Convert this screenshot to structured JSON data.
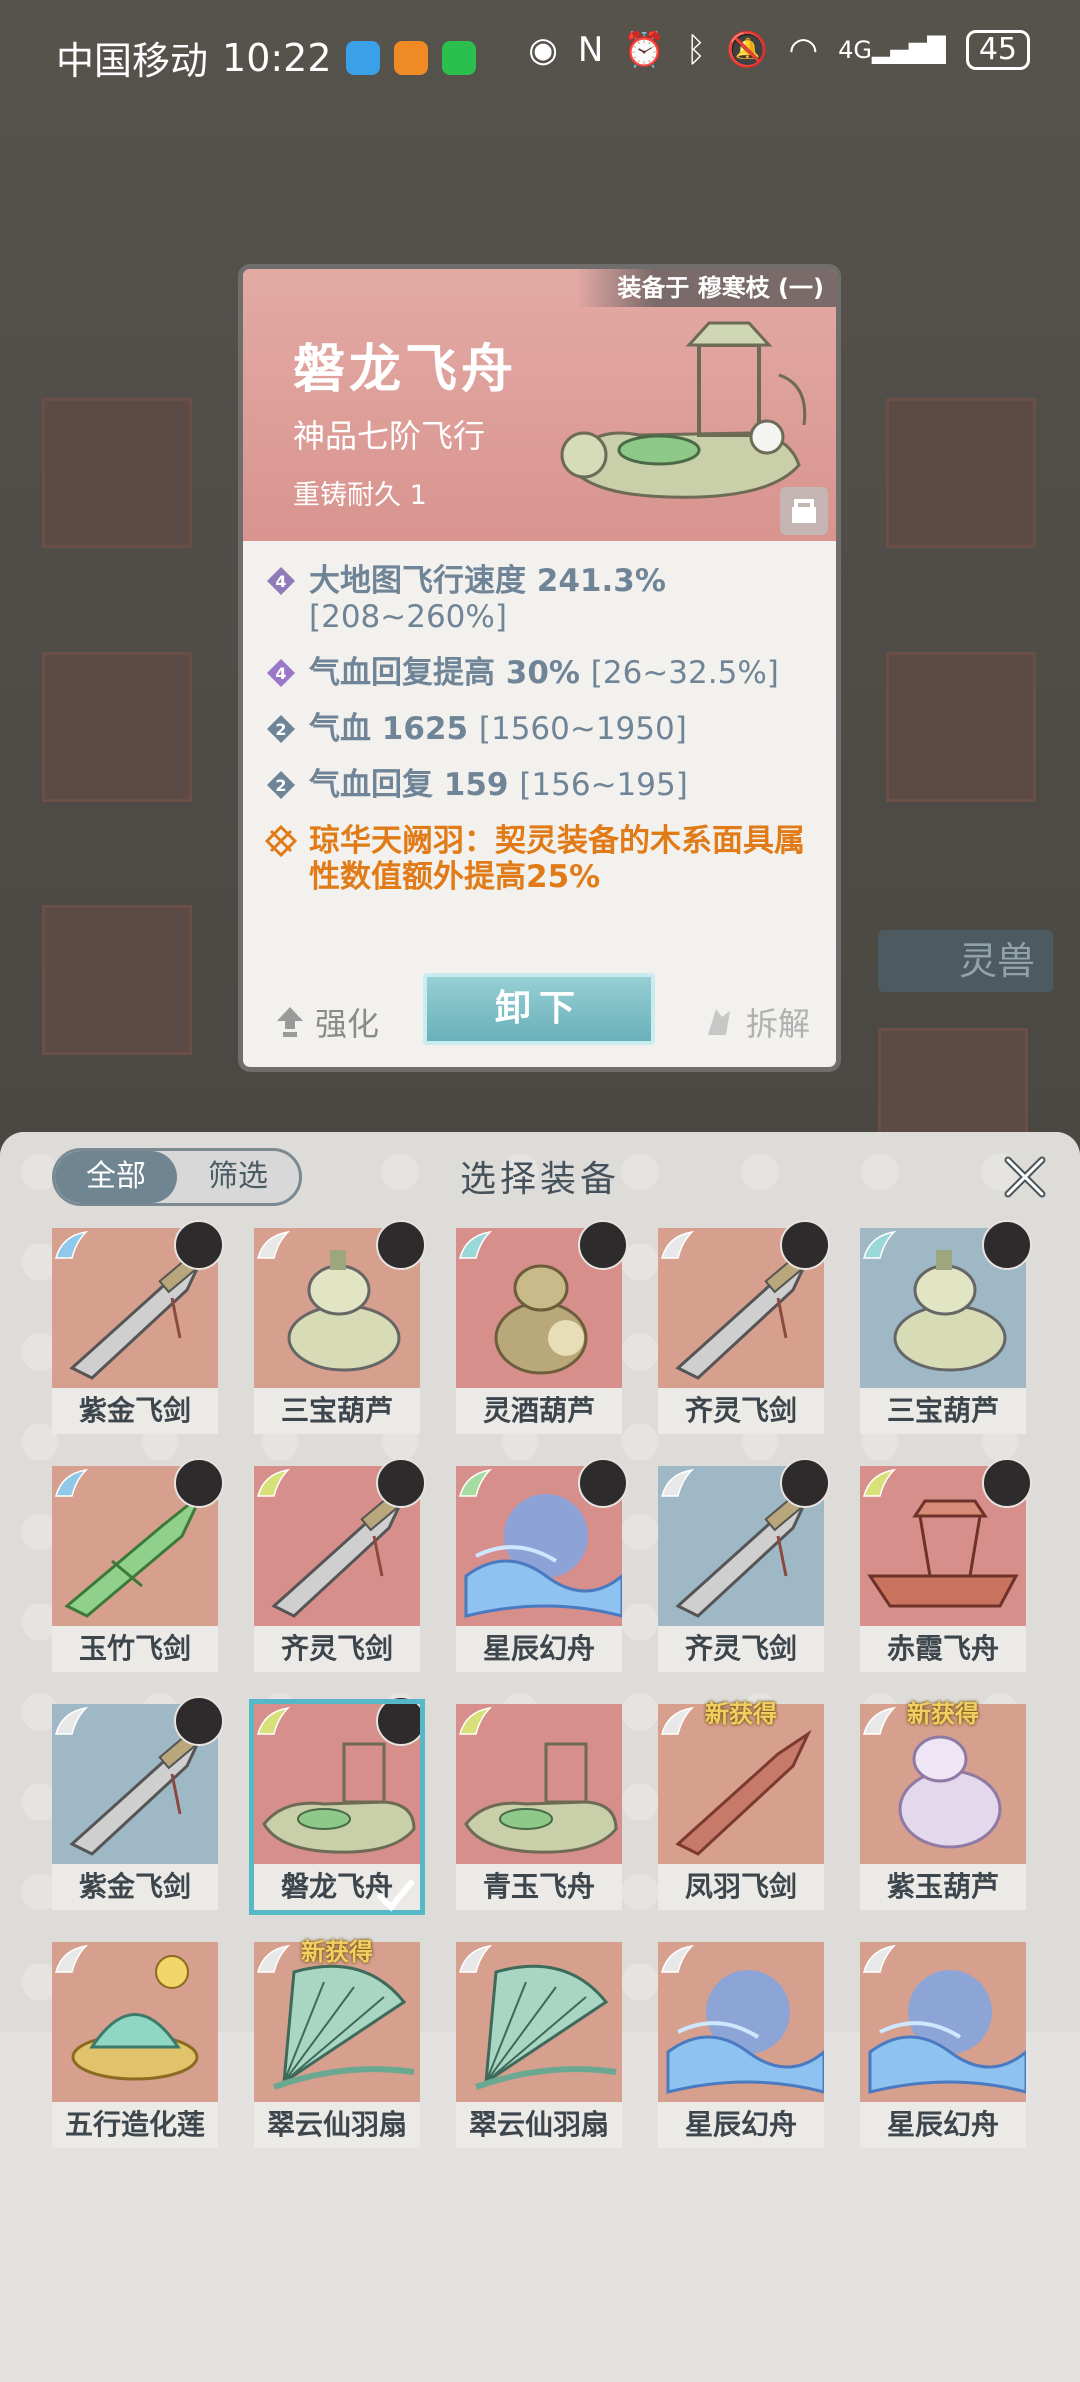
{
  "status_bar": {
    "carrier": "中国移动",
    "time": "10:22",
    "battery": "45",
    "network": "4G"
  },
  "background": {
    "side_tab": "灵兽"
  },
  "item_popup": {
    "equipped_on": "装备于 穆寒枝 (一)",
    "name": "磐龙飞舟",
    "grade": "神品七阶飞行",
    "durability": "重铸耐久 1",
    "attributes": [
      {
        "text": "大地图飞行速度 241.3%",
        "range": "[208~260%]",
        "badge": "4",
        "color": "#8e7bb7"
      },
      {
        "text": "气血回复提高 30%",
        "range": "[26~32.5%]",
        "badge": "4",
        "color": "#9b77c9"
      },
      {
        "text": "气血 1625",
        "range": "[1560~1950]",
        "badge": "2",
        "color": "#6f8597"
      },
      {
        "text": "气血回复 159",
        "range": "[156~195]",
        "badge": "2",
        "color": "#6f8597"
      }
    ],
    "special": "琼华天阙羽：契灵装备的木系面具属性数值额外提高25%",
    "strengthen": "强化",
    "unequip": "卸下",
    "dismantle": "拆解"
  },
  "sheet": {
    "title": "选择装备",
    "tabs": [
      "全部",
      "筛选"
    ],
    "active_tab": 0,
    "new_label": "新获得",
    "items": [
      {
        "name": "紫金飞剑",
        "bg": "#d7a08e",
        "art": "sword",
        "wing": "#8fc8e8",
        "avatar": true
      },
      {
        "name": "三宝葫芦",
        "bg": "#d7a08e",
        "art": "gourd",
        "wing": "#e8e8e8",
        "avatar": true
      },
      {
        "name": "灵酒葫芦",
        "bg": "#d78f8c",
        "art": "gourd2",
        "wing": "#9ad7d9",
        "avatar": true
      },
      {
        "name": "齐灵飞剑",
        "bg": "#d7a08e",
        "art": "sword",
        "wing": "#e8e8e8",
        "avatar": true
      },
      {
        "name": "三宝葫芦",
        "bg": "#9fb8c6",
        "art": "gourd",
        "wing": "#9ad7d9",
        "avatar": true
      },
      {
        "name": "玉竹飞剑",
        "bg": "#d7a08e",
        "art": "greensword",
        "wing": "#8fc8e8",
        "avatar": true
      },
      {
        "name": "齐灵飞剑",
        "bg": "#d78f8c",
        "art": "sword",
        "wing": "#d8e07a",
        "avatar": true
      },
      {
        "name": "星辰幻舟",
        "bg": "#d78f8c",
        "art": "bluewave",
        "wing": "#a7dca0",
        "avatar": true
      },
      {
        "name": "齐灵飞剑",
        "bg": "#9fb8c6",
        "art": "sword",
        "wing": "#e8e8e8",
        "avatar": true
      },
      {
        "name": "赤霞飞舟",
        "bg": "#d78f8c",
        "art": "redboat",
        "wing": "#d8e07a",
        "avatar": true
      },
      {
        "name": "紫金飞剑",
        "bg": "#9fb8c6",
        "art": "sword",
        "wing": "#e8e8e8",
        "avatar": true
      },
      {
        "name": "磐龙飞舟",
        "bg": "#d78f8c",
        "art": "boat",
        "wing": "#d8e07a",
        "avatar": true,
        "selected": true
      },
      {
        "name": "青玉飞舟",
        "bg": "#d78f8c",
        "art": "boat",
        "wing": "#d8e07a",
        "avatar": false
      },
      {
        "name": "凤羽飞剑",
        "bg": "#d7a08e",
        "art": "redsword",
        "wing": "#e8e8e8",
        "avatar": false,
        "new": true
      },
      {
        "name": "紫玉葫芦",
        "bg": "#d7a08e",
        "art": "purplegourd",
        "wing": "#e8e8e8",
        "avatar": false,
        "new": true
      },
      {
        "name": "五行造化莲",
        "bg": "#d7a08e",
        "art": "lotus",
        "wing": "#e8e8e8",
        "avatar": false
      },
      {
        "name": "翠云仙羽扇",
        "bg": "#d7a08e",
        "art": "fan",
        "wing": "#e8e8e8",
        "avatar": false,
        "new": true
      },
      {
        "name": "翠云仙羽扇",
        "bg": "#d7a08e",
        "art": "fan",
        "wing": "#e8e8e8",
        "avatar": false
      },
      {
        "name": "星辰幻舟",
        "bg": "#d7a08e",
        "art": "bluewave",
        "wing": "#e8e8e8",
        "avatar": false
      },
      {
        "name": "星辰幻舟",
        "bg": "#d7a08e",
        "art": "bluewave",
        "wing": "#e8e8e8",
        "avatar": false
      }
    ]
  }
}
